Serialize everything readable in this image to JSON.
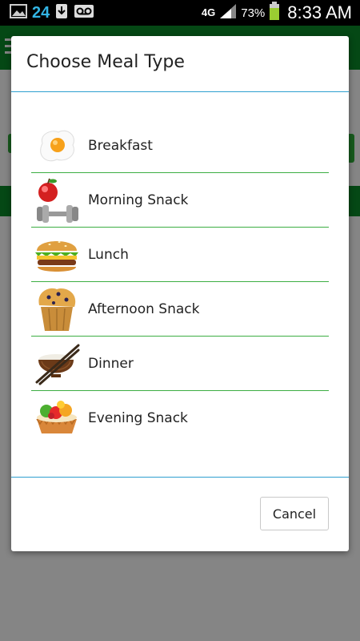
{
  "status_bar": {
    "notification_count": "24",
    "network_type": "4G",
    "battery_percent": "73%",
    "time": "8:33 AM",
    "icons": [
      "image-icon",
      "download-icon",
      "voicemail-icon",
      "signal-icon",
      "battery-icon"
    ]
  },
  "dialog": {
    "title": "Choose Meal Type",
    "items": [
      {
        "label": "Breakfast",
        "icon": "fried-egg-icon"
      },
      {
        "label": "Morning Snack",
        "icon": "apple-dumbbell-icon"
      },
      {
        "label": "Lunch",
        "icon": "burger-icon"
      },
      {
        "label": "Afternoon Snack",
        "icon": "muffin-icon"
      },
      {
        "label": "Dinner",
        "icon": "rice-bowl-chopsticks-icon"
      },
      {
        "label": "Evening Snack",
        "icon": "fruit-tart-icon"
      }
    ],
    "cancel_label": "Cancel"
  },
  "colors": {
    "accent_divider": "#2fa0d0",
    "item_separator": "#3cae43",
    "app_header": "#0a8a2a"
  }
}
